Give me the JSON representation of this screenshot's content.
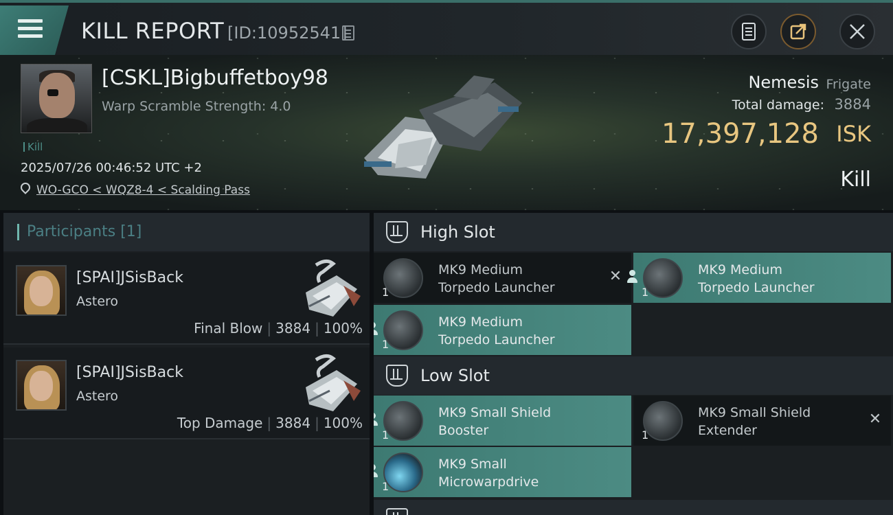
{
  "header": {
    "title": "KILL REPORT",
    "report_id": "[ID:10952541]"
  },
  "victim": {
    "name": "[CSKL]Bigbuffetboy98",
    "warp_scramble": "Warp Scramble Strength: 4.0",
    "kill_tag": "Kill",
    "datetime": "2025/07/26 00:46:52 UTC +2",
    "location": "WO-GCO < WQZ8-4 < Scalding Pass",
    "ship_name": "Nemesis",
    "ship_class": "Frigate",
    "damage_label": "Total damage:",
    "damage_value": "3884",
    "isk_value": "17,397,128",
    "isk_unit": "ISK",
    "kill_type": "Kill"
  },
  "participants": {
    "title": "Participants [1]",
    "list": [
      {
        "name": "[SPAI]JSisBack",
        "ship": "Astero",
        "role": "Final Blow",
        "damage": "3884",
        "percent": "100%"
      },
      {
        "name": "[SPAI]JSisBack",
        "ship": "Astero",
        "role": "Top Damage",
        "damage": "3884",
        "percent": "100%"
      }
    ]
  },
  "fitting": {
    "high_slot": {
      "title": "High Slot",
      "modules": [
        {
          "qty": "1",
          "name_line1": "MK9 Medium",
          "name_line2": "Torpedo Launcher",
          "status": "destroyed"
        },
        {
          "qty": "1",
          "name_line1": "MK9 Medium",
          "name_line2": "Torpedo Launcher",
          "status": "dropped"
        },
        {
          "qty": "1",
          "name_line1": "MK9 Medium",
          "name_line2": "Torpedo Launcher",
          "status": "dropped"
        }
      ]
    },
    "low_slot": {
      "title": "Low Slot",
      "modules": [
        {
          "qty": "1",
          "name_line1": "MK9 Small Shield",
          "name_line2": "Booster",
          "status": "dropped"
        },
        {
          "qty": "1",
          "name_line1": "MK9 Small Shield",
          "name_line2": "Extender",
          "status": "destroyed"
        },
        {
          "qty": "1",
          "name_line1": "MK9 Small",
          "name_line2": "Microwarpdrive",
          "status": "dropped"
        }
      ]
    }
  },
  "colors": {
    "accent": "#3d7a72",
    "isk": "#e8c680",
    "participants_title": "#4b7f84"
  }
}
